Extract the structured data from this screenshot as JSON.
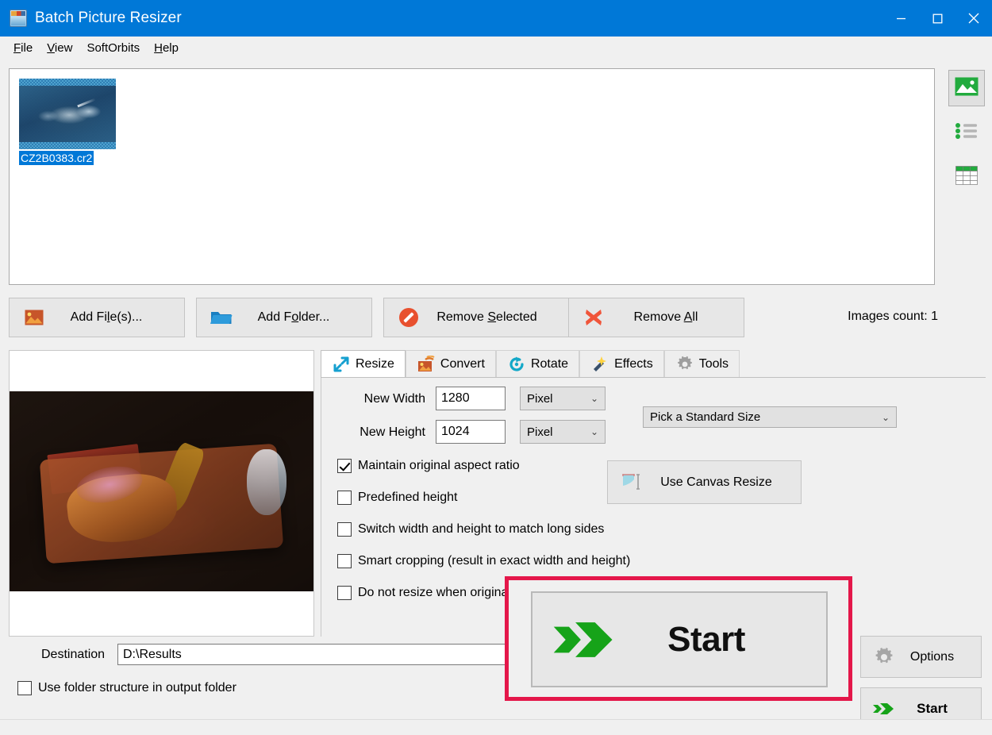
{
  "window": {
    "title": "Batch Picture Resizer",
    "icon": "app-icon",
    "controls": {
      "minimize": "minimize-icon",
      "maximize": "maximize-icon",
      "close": "close-icon"
    }
  },
  "menubar": {
    "items": [
      {
        "label": "File",
        "accel": "F"
      },
      {
        "label": "View",
        "accel": "V"
      },
      {
        "label": "SoftOrbits",
        "accel": ""
      },
      {
        "label": "Help",
        "accel": "H"
      }
    ]
  },
  "filelist": {
    "items": [
      {
        "filename": "CZ2B0383.cr2",
        "selected": true
      }
    ]
  },
  "view_modes": [
    {
      "name": "thumbnail-view",
      "icon": "picture-icon",
      "active": true
    },
    {
      "name": "list-view",
      "icon": "list-icon",
      "active": false
    },
    {
      "name": "details-view",
      "icon": "table-icon",
      "active": false
    }
  ],
  "toolbar": {
    "add_files": {
      "label": "Add File(s)...",
      "pre": "Add Fi",
      "accel": "l",
      "post": "e(s)...",
      "icon": "picture-add-icon"
    },
    "add_folder": {
      "label": "Add Folder...",
      "pre": "Add F",
      "accel": "o",
      "post": "lder...",
      "icon": "folder-icon"
    },
    "remove_selected": {
      "label": "Remove Selected",
      "pre": "Remove ",
      "accel": "S",
      "post": "elected",
      "icon": "forbidden-icon"
    },
    "remove_all": {
      "label": "Remove All",
      "pre": "Remove ",
      "accel": "A",
      "post": "ll",
      "icon": "red-x-icon"
    },
    "images_count": "Images count: 1"
  },
  "tabs": [
    {
      "label": "Resize",
      "icon": "resize-arrows-icon",
      "active": true
    },
    {
      "label": "Convert",
      "icon": "convert-icon",
      "active": false
    },
    {
      "label": "Rotate",
      "icon": "rotate-icon",
      "active": false
    },
    {
      "label": "Effects",
      "icon": "magic-wand-icon",
      "active": false
    },
    {
      "label": "Tools",
      "icon": "gear-icon",
      "active": false
    }
  ],
  "resize": {
    "new_width": {
      "label": "New Width",
      "value": "1280",
      "unit": "Pixel"
    },
    "new_height": {
      "label": "New Height",
      "value": "1024",
      "unit": "Pixel"
    },
    "standard_size": {
      "value": "Pick a Standard Size"
    },
    "canvas_resize": {
      "label": "Use Canvas Resize",
      "icon": "canvas-resize-icon"
    },
    "checkboxes": [
      {
        "label": "Maintain original aspect ratio",
        "checked": true
      },
      {
        "label": "Predefined height",
        "checked": false
      },
      {
        "label": "Switch width and height to match long sides",
        "checked": false
      },
      {
        "label": "Smart cropping (result in exact width and height)",
        "checked": false
      },
      {
        "label": "Do not resize when original is smaller",
        "checked": false
      }
    ]
  },
  "destination": {
    "label": "Destination",
    "value": "D:\\Results",
    "use_folder_structure": {
      "label": "Use folder structure in output folder",
      "checked": false
    }
  },
  "footer": {
    "options": {
      "label": "Options",
      "icon": "gear-icon"
    },
    "start": {
      "label": "Start",
      "icon": "green-arrow-icon"
    }
  },
  "callout": {
    "label": "Start",
    "icon": "green-arrow-icon",
    "border_color": "#e4174a"
  },
  "colors": {
    "titlebar": "#0078d7",
    "accent_green": "#16a319",
    "highlight_red": "#e4174a",
    "selection_blue": "#0078d7"
  }
}
